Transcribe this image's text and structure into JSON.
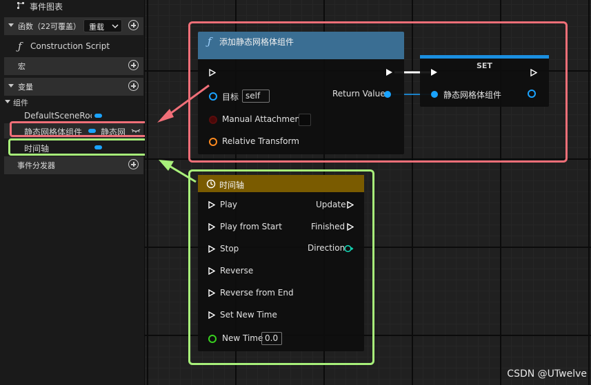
{
  "sidebar": {
    "event_graph": "事件图表",
    "functions": {
      "title": "函数（22可覆盖）",
      "override_label": "重载"
    },
    "construction_script": "Construction Script",
    "macros": {
      "title": "宏"
    },
    "variables": {
      "title": "变量"
    },
    "components": {
      "title": "组件",
      "items": [
        {
          "name": "DefaultSceneRoot",
          "display": "DefaultSceneRoc"
        },
        {
          "name": "静态网格体组件",
          "type_label": "静态网"
        },
        {
          "name": "时间轴"
        }
      ]
    },
    "event_dispatchers": {
      "title": "事件分发器"
    }
  },
  "nodes": {
    "add_component": {
      "title": "添加静态网格体组件",
      "pins": {
        "target": "目标",
        "target_value": "self",
        "return_value": "Return Value",
        "manual_attachment": "Manual Attachment",
        "relative_transform": "Relative Transform"
      }
    },
    "set_node": {
      "title": "SET",
      "pin": "静态网格体组件"
    },
    "timeline": {
      "title": "时间轴",
      "inputs": [
        "Play",
        "Play from Start",
        "Stop",
        "Reverse",
        "Reverse from End",
        "Set New Time"
      ],
      "outputs": [
        "Update",
        "Finished",
        "Direction"
      ],
      "new_time_label": "New Time",
      "new_time_value": "0.0"
    }
  },
  "colors": {
    "accent": "#1aa3ff",
    "function_header": "#3a6e93",
    "timeline_header": "#7a5b00",
    "highlight_red": "#f06f78",
    "highlight_green": "#a8f07a"
  },
  "watermark": "CSDN @UTwelve"
}
